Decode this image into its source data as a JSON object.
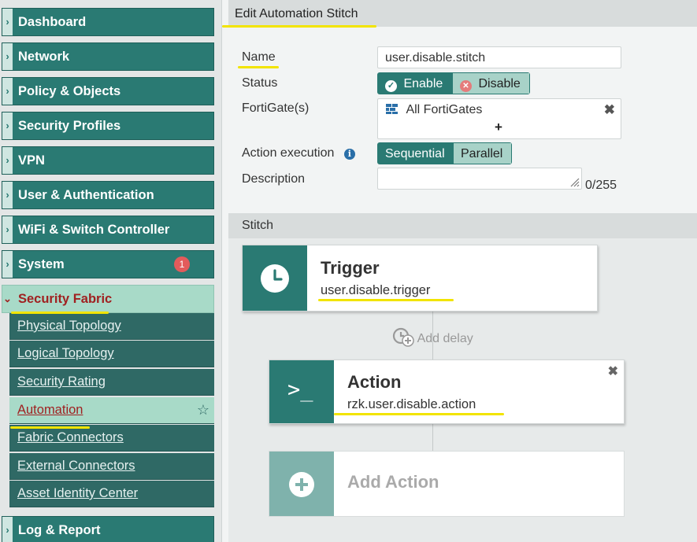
{
  "sidebar": {
    "items": [
      {
        "label": "Dashboard"
      },
      {
        "label": "Network"
      },
      {
        "label": "Policy & Objects"
      },
      {
        "label": "Security Profiles"
      },
      {
        "label": "VPN"
      },
      {
        "label": "User & Authentication"
      },
      {
        "label": "WiFi & Switch Controller"
      },
      {
        "label": "System",
        "badge": "1"
      },
      {
        "label": "Security Fabric"
      },
      {
        "label": "Log & Report"
      }
    ],
    "fabric_sub": [
      {
        "label": "Physical Topology"
      },
      {
        "label": "Logical Topology"
      },
      {
        "label": "Security Rating"
      },
      {
        "label": "Automation"
      },
      {
        "label": "Fabric Connectors"
      },
      {
        "label": "External Connectors"
      },
      {
        "label": "Asset Identity Center"
      }
    ]
  },
  "header": {
    "title": "Edit Automation Stitch"
  },
  "form": {
    "name_label": "Name",
    "name_value": "user.disable.stitch",
    "status_label": "Status",
    "status_enable": "Enable",
    "status_disable": "Disable",
    "fortigates_label": "FortiGate(s)",
    "fortigates_value": "All FortiGates",
    "fortigates_add": "+",
    "action_exec_label": "Action execution",
    "exec_sequential": "Sequential",
    "exec_parallel": "Parallel",
    "description_label": "Description",
    "description_counter": "0/255"
  },
  "stitch": {
    "title": "Stitch",
    "trigger_title": "Trigger",
    "trigger_name": "user.disable.trigger",
    "add_delay": "Add delay",
    "action_title": "Action",
    "action_name": "rzk.user.disable.action",
    "add_action": "Add Action"
  },
  "colors": {
    "accent": "#2a7a73",
    "active_nav": "#a8dac8",
    "highlight": "#f2e400"
  }
}
